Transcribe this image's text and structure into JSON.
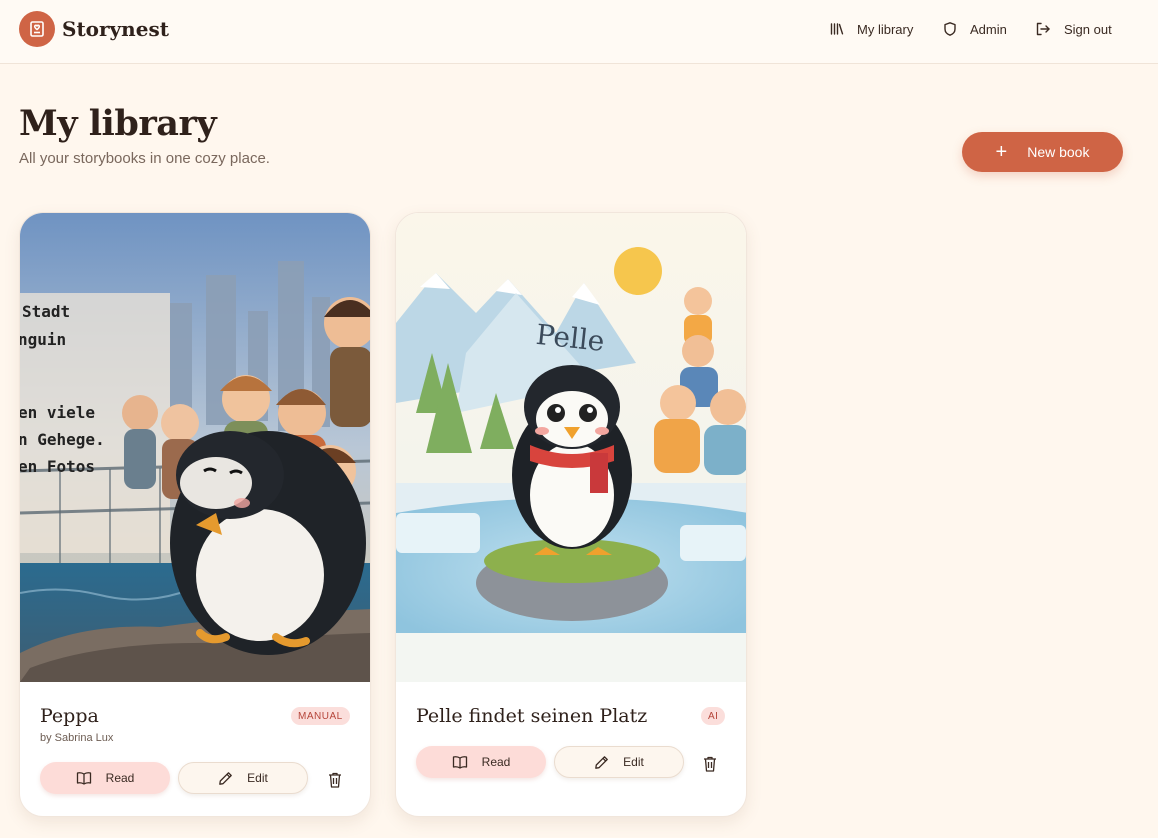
{
  "app": {
    "name": "Storynest"
  },
  "nav": [
    {
      "label": "My library",
      "icon": "library-icon"
    },
    {
      "label": "Admin",
      "icon": "shield-icon"
    },
    {
      "label": "Sign out",
      "icon": "sign-out-icon"
    }
  ],
  "page": {
    "title": "My library",
    "subtitle": "All your storybooks in one cozy place.",
    "new_book_label": "New book"
  },
  "books": [
    {
      "title": "Peppa",
      "author": "by Sabrina Lux",
      "badge": "MANUAL",
      "read_label": "Read",
      "edit_label": "Edit",
      "cover_text": [
        "Stadt",
        "nguin",
        "en viele",
        "n Gehege.",
        "en Fotos"
      ]
    },
    {
      "title": "Pelle findet seinen Platz",
      "author": "",
      "badge": "AI",
      "read_label": "Read",
      "edit_label": "Edit",
      "cover_text": [
        "Pelle"
      ]
    }
  ],
  "colors": {
    "accent": "#cf6445",
    "background": "#fff7ee",
    "badge_bg": "#fbdedb",
    "read_button_bg": "#fddcd8"
  }
}
